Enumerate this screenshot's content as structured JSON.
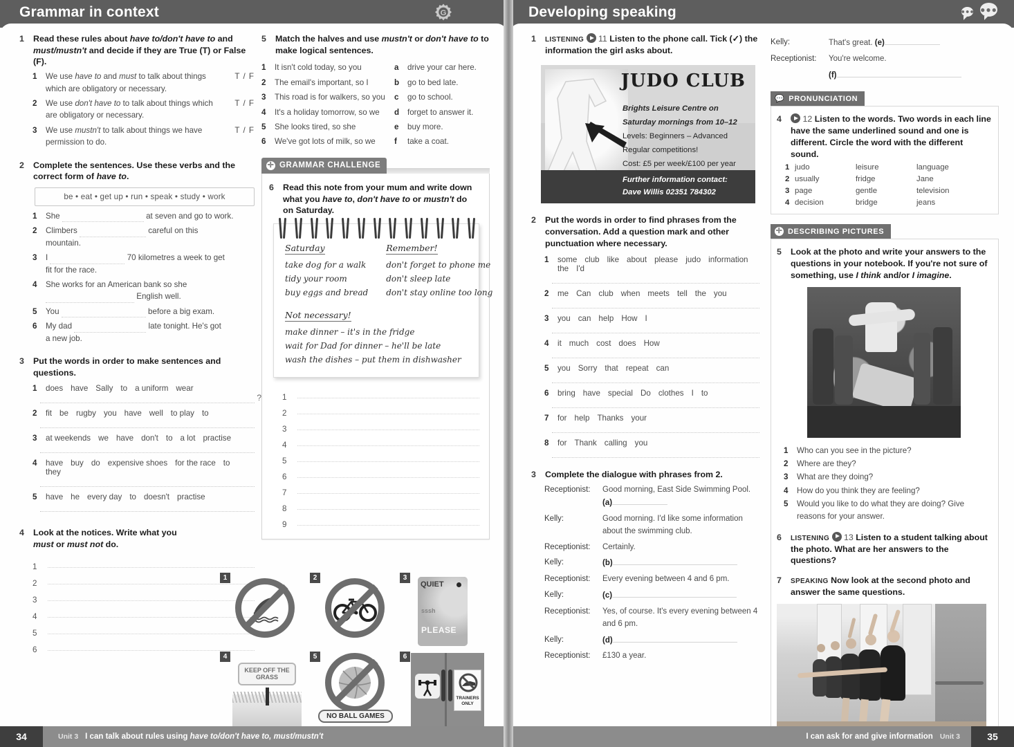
{
  "left_page": {
    "banner_title": "Grammar in context",
    "gear_letter": "G",
    "exercises": [
      {
        "num": "1",
        "instruction_parts": [
          "Read these rules about ",
          "have to/don't have to",
          " and ",
          "must/mustn't",
          " and decide if they are True (T) or False (F)."
        ],
        "items": [
          {
            "n": "1",
            "text": "We use have to and must to talk about things which are obligatory or necessary.",
            "tf": "T / F"
          },
          {
            "n": "2",
            "text": "We use don't have to to talk about things which are obligatory or necessary.",
            "tf": "T / F"
          },
          {
            "n": "3",
            "text": "We use mustn't to talk about things we have permission to do.",
            "tf": "T / F"
          }
        ]
      },
      {
        "num": "2",
        "instruction": "Complete the sentences. Use these verbs and the correct form of have to.",
        "wordbank": "be  •  eat  •  get up  •  run  •  speak  •  study  •  work",
        "items": [
          {
            "n": "1",
            "before": "She",
            "after": "at seven and go to work."
          },
          {
            "n": "2",
            "before": "Climbers",
            "after": "careful on this",
            "cont": "mountain."
          },
          {
            "n": "3",
            "before": "I",
            "after": "70 kilometres a week to get",
            "cont": "fit for the race."
          },
          {
            "n": "4",
            "before": "She works for an American bank so she",
            "after": "",
            "cont2": "English well."
          },
          {
            "n": "5",
            "before": "You",
            "after": "before a big exam."
          },
          {
            "n": "6",
            "before": "My dad",
            "after": "late tonight. He's got",
            "cont": "a new job."
          }
        ]
      },
      {
        "num": "3",
        "instruction": "Put the words in order to make sentences and questions.",
        "items": [
          {
            "n": "1",
            "words": [
              "does",
              "have",
              "Sally",
              "to",
              "a uniform",
              "wear"
            ],
            "qmark": "?"
          },
          {
            "n": "2",
            "words": [
              "fit",
              "be",
              "rugby",
              "you",
              "have",
              "well",
              "to play",
              "to"
            ],
            "qmark": "."
          },
          {
            "n": "3",
            "words": [
              "at weekends",
              "we",
              "have",
              "don't",
              "to",
              "a lot",
              "practise"
            ],
            "qmark": "."
          },
          {
            "n": "4",
            "words": [
              "have",
              "buy",
              "do",
              "expensive shoes",
              "for the race",
              "to",
              "they"
            ],
            "qmark": "."
          },
          {
            "n": "5",
            "words": [
              "have",
              "he",
              "every day",
              "to",
              "doesn't",
              "practise"
            ],
            "qmark": "."
          }
        ]
      },
      {
        "num": "4",
        "instruction": "Look at the notices. Write what you must or must not do.",
        "lines": [
          "1",
          "2",
          "3",
          "4",
          "5",
          "6"
        ]
      },
      {
        "num": "5",
        "instruction": "Match the halves and use mustn't or don't have to to make logical sentences.",
        "left_items": [
          {
            "n": "1",
            "text": "It isn't cold today, so you"
          },
          {
            "n": "2",
            "text": "The email's important, so I"
          },
          {
            "n": "3",
            "text": "This road is for walkers, so you"
          },
          {
            "n": "4",
            "text": "It's a holiday tomorrow, so we"
          },
          {
            "n": "5",
            "text": "She looks tired, so she"
          },
          {
            "n": "6",
            "text": "We've got lots of milk, so we"
          }
        ],
        "right_items": [
          {
            "n": "a",
            "text": "drive your car here."
          },
          {
            "n": "b",
            "text": "go to bed late."
          },
          {
            "n": "c",
            "text": "go to school."
          },
          {
            "n": "d",
            "text": "forget to answer it."
          },
          {
            "n": "e",
            "text": "buy more."
          },
          {
            "n": "f",
            "text": "take a coat."
          }
        ]
      }
    ],
    "grammar_challenge": {
      "tab_label": "GRAMMAR CHALLENGE",
      "tab_icon": "plus-circle-icon",
      "num": "6",
      "instruction": "Read this note from your mum and write down what you have to, don't have to or mustn't do on Saturday.",
      "note": {
        "col1_heading": "Saturday",
        "col1_lines": [
          "take dog for a walk",
          "tidy your room",
          "buy eggs and bread"
        ],
        "col2_heading": "Remember!",
        "col2_lines": [
          "don't forget to phone me",
          "don't sleep late",
          "don't stay online too long"
        ],
        "col3_heading": "Not necessary!",
        "col3_lines": [
          "make dinner – it's in the fridge",
          "wait for Dad for dinner – he'll be late",
          "wash the dishes – put them in dishwasher"
        ]
      },
      "answer_lines": [
        "1",
        "2",
        "3",
        "4",
        "5",
        "6",
        "7",
        "8",
        "9"
      ]
    },
    "notices": [
      {
        "n": "1",
        "type": "no-diving-icon",
        "caption": ""
      },
      {
        "n": "2",
        "type": "no-cycling-icon",
        "caption": ""
      },
      {
        "n": "3",
        "type": "quiet-please-sign",
        "caption_top": "QUIET",
        "caption_mid": "sssh",
        "caption_bottom": "PLEASE"
      },
      {
        "n": "4",
        "type": "keep-off-grass-sign",
        "caption": "KEEP OFF THE GRASS"
      },
      {
        "n": "5",
        "type": "no-ball-games-icon",
        "caption": "NO BALL GAMES"
      },
      {
        "n": "6",
        "type": "gym-trainers-only-sign",
        "caption": "TRAINERS ONLY"
      }
    ],
    "footer": {
      "page_number": "34",
      "unit": "Unit 3",
      "can_do_pre": "I can talk about rules using ",
      "can_do_italic": "have to/don't have to, must/mustn't"
    }
  },
  "right_page": {
    "banner_title": "Developing speaking",
    "exercises": [
      {
        "num": "1",
        "tag": "LISTENING",
        "track": "11",
        "instruction": "Listen to the phone call. Tick (✓) the information the girl asks about."
      },
      {
        "num": "2",
        "instruction": "Put the words in order to find phrases from the conversation. Add a question mark and other punctuation where necessary.",
        "items": [
          {
            "n": "1",
            "words": [
              "some",
              "club",
              "like",
              "about",
              "please",
              "judo",
              "information",
              "the",
              "I'd"
            ]
          },
          {
            "n": "2",
            "words": [
              "me",
              "Can",
              "club",
              "when",
              "meets",
              "tell",
              "the",
              "you"
            ]
          },
          {
            "n": "3",
            "words": [
              "you",
              "can",
              "help",
              "How",
              "I"
            ]
          },
          {
            "n": "4",
            "words": [
              "it",
              "much",
              "cost",
              "does",
              "How"
            ]
          },
          {
            "n": "5",
            "words": [
              "you",
              "Sorry",
              "that",
              "repeat",
              "can"
            ]
          },
          {
            "n": "6",
            "words": [
              "bring",
              "have",
              "special",
              "Do",
              "clothes",
              "I",
              "to"
            ]
          },
          {
            "n": "7",
            "words": [
              "for",
              "help",
              "Thanks",
              "your"
            ]
          },
          {
            "n": "8",
            "words": [
              "for",
              "Thank",
              "calling",
              "you"
            ]
          }
        ]
      },
      {
        "num": "3",
        "instruction": "Complete the dialogue with phrases from 2.",
        "dialogue": [
          {
            "who": "Receptionist:",
            "text": "Good morning, East Side Swimming Pool.",
            "marker": "(a)"
          },
          {
            "who": "Kelly:",
            "text": "Good morning. I'd like some information about the swimming club.",
            "marker": ""
          },
          {
            "who": "Receptionist:",
            "text": "Certainly.",
            "marker": ""
          },
          {
            "who": "Kelly:",
            "text": "",
            "marker": "(b)"
          },
          {
            "who": "Receptionist:",
            "text": "Every evening between 4 and 6 pm.",
            "marker": ""
          },
          {
            "who": "Kelly:",
            "text": "",
            "marker": "(c)"
          },
          {
            "who": "Receptionist:",
            "text": "Yes, of course. It's every evening between 4 and 6 pm.",
            "marker": ""
          },
          {
            "who": "Kelly:",
            "text": "",
            "marker": "(d)"
          },
          {
            "who": "Receptionist:",
            "text": "£130 a year.",
            "marker": ""
          },
          {
            "who": "Kelly:",
            "text": "That's great.",
            "marker": "(e)"
          },
          {
            "who": "Receptionist:",
            "text": "You're welcome.",
            "marker": ""
          },
          {
            "who": "",
            "text": "",
            "marker": "(f)"
          }
        ]
      }
    ],
    "judo_poster": {
      "title": "JUDO CLUB",
      "line1": "Brights Leisure Centre on Saturday mornings from 10–12",
      "line2": "Levels: Beginners – Advanced",
      "line3": "Regular competitions!",
      "line4": "Cost: £5 per week/£100 per year",
      "contact_heading": "Further information contact:",
      "contact_detail": "Dave Willis 02351 784302"
    },
    "pronunciation": {
      "tab_label": "PRONUNCIATION",
      "tab_icon": "speech-bubble-icon",
      "num": "4",
      "track": "12",
      "instruction": "Listen to the words. Two words in each line have the same underlined sound and one is different. Circle the word with the different sound.",
      "rows": [
        {
          "n": "1",
          "a": "judo",
          "b": "leisure",
          "c": "language"
        },
        {
          "n": "2",
          "a": "usually",
          "b": "fridge",
          "c": "Jane"
        },
        {
          "n": "3",
          "a": "page",
          "b": "gentle",
          "c": "television"
        },
        {
          "n": "4",
          "a": "decision",
          "b": "bridge",
          "c": "jeans"
        }
      ]
    },
    "describing_pictures": {
      "tab_label": "DESCRIBING PICTURES",
      "tab_icon": "plus-circle-icon",
      "ex5": {
        "num": "5",
        "instruction": "Look at the photo and write your answers to the questions in your notebook. If you're not sure of something, use I think and/or I imagine."
      },
      "photo1_alt": "breakdancer-street-photo",
      "questions": [
        {
          "n": "1",
          "text": "Who can you see in the picture?"
        },
        {
          "n": "2",
          "text": "Where are they?"
        },
        {
          "n": "3",
          "text": "What are they doing?"
        },
        {
          "n": "4",
          "text": "How do you think they are feeling?"
        },
        {
          "n": "5",
          "text": "Would you like to do what they are doing? Give reasons for your answer."
        }
      ],
      "ex6": {
        "num": "6",
        "tag": "LISTENING",
        "track": "13",
        "instruction": "Listen to a student talking about the photo. What are her answers to the questions?"
      },
      "ex7": {
        "num": "7",
        "tag": "SPEAKING",
        "instruction": "Now look at the second photo and answer the same questions."
      },
      "photo2_alt": "ballet-class-photo"
    },
    "footer": {
      "page_number": "35",
      "unit": "Unit 3",
      "can_do": "I can ask for and give information"
    }
  },
  "colors": {
    "banner": "#5e5e5e",
    "tab": "#7d7d7d",
    "footer": "#8c8c8c",
    "page_num_bg": "#3e3e3e",
    "body_text": "#4a4a4a",
    "heading_text": "#1c1c1c"
  }
}
